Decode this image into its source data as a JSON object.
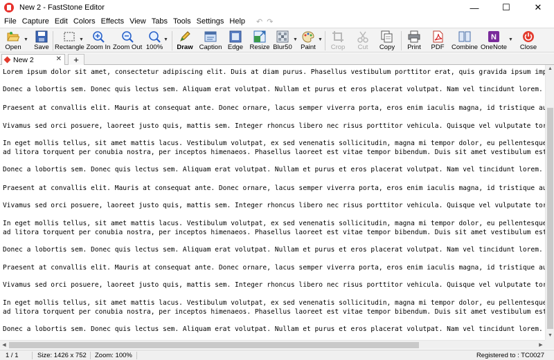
{
  "window": {
    "title": "New 2 - FastStone Editor",
    "minimize_glyph": "—",
    "maximize_glyph": "☐",
    "close_glyph": "✕"
  },
  "menu": [
    "File",
    "Capture",
    "Edit",
    "Colors",
    "Effects",
    "View",
    "Tabs",
    "Tools",
    "Settings",
    "Help"
  ],
  "menu_undo_glyph": "↶",
  "menu_redo_glyph": "↷",
  "toolbar": {
    "open": "Open",
    "save": "Save",
    "rectangle": "Rectangle",
    "zoom_in": "Zoom In",
    "zoom_out": "Zoom Out",
    "zoom_level": "100%",
    "draw": "Draw",
    "caption": "Caption",
    "edge": "Edge",
    "resize": "Resize",
    "blur": "Blur50",
    "paint": "Paint",
    "crop": "Crop",
    "cut": "Cut",
    "copy": "Copy",
    "print": "Print",
    "pdf": "PDF",
    "combine": "Combine",
    "onenote": "OneNote",
    "close": "Close"
  },
  "tabs": {
    "active_label": "New 2",
    "close_glyph": "✕",
    "add_glyph": "+"
  },
  "document": {
    "lines": [
      "Lorem ipsum dolor sit amet, consectetur adipiscing elit. Duis at diam purus. Phasellus vestibulum porttitor erat, quis gravida ipsum imper",
      "Donec a lobortis sem. Donec quis lectus sem. Aliquam erat volutpat. Nullam et purus et eros placerat volutpat. Nam vel tincidunt lorem. Ve",
      "Praesent at convallis elit. Mauris at consequat ante. Donec ornare, lacus semper viverra porta, eros enim iaculis magna, id tristique augu",
      "Vivamus sed orci posuere, laoreet justo quis, mattis sem. Integer rhoncus libero nec risus porttitor vehicula. Quisque vel vulputate torto",
      "In eget mollis tellus, sit amet mattis lacus. Vestibulum volutpat, ex sed venenatis sollicitudin, magna mi tempor dolor, eu pellentesque n",
      "ad litora torquent per conubia nostra, per inceptos himenaeos. Phasellus laoreet est vitae tempor bibendum. Duis sit amet vestibulum est.",
      "Donec a lobortis sem. Donec quis lectus sem. Aliquam erat volutpat. Nullam et purus et eros placerat volutpat. Nam vel tincidunt lorem. Ve",
      "Praesent at convallis elit. Mauris at consequat ante. Donec ornare, lacus semper viverra porta, eros enim iaculis magna, id tristique augu",
      "Vivamus sed orci posuere, laoreet justo quis, mattis sem. Integer rhoncus libero nec risus porttitor vehicula. Quisque vel vulputate torto",
      "In eget mollis tellus, sit amet mattis lacus. Vestibulum volutpat, ex sed venenatis sollicitudin, magna mi tempor dolor, eu pellentesque n",
      "ad litora torquent per conubia nostra, per inceptos himenaeos. Phasellus laoreet est vitae tempor bibendum. Duis sit amet vestibulum est.",
      "Donec a lobortis sem. Donec quis lectus sem. Aliquam erat volutpat. Nullam et purus et eros placerat volutpat. Nam vel tincidunt lorem. Ve",
      "Praesent at convallis elit. Mauris at consequat ante. Donec ornare, lacus semper viverra porta, eros enim iaculis magna, id tristique augu",
      "Vivamus sed orci posuere, laoreet justo quis, mattis sem. Integer rhoncus libero nec risus porttitor vehicula. Quisque vel vulputate torto",
      "In eget mollis tellus, sit amet mattis lacus. Vestibulum volutpat, ex sed venenatis sollicitudin, magna mi tempor dolor, eu pellentesque n",
      "ad litora torquent per conubia nostra, per inceptos himenaeos. Phasellus laoreet est vitae tempor bibendum. Duis sit amet vestibulum est.",
      "Donec a lobortis sem. Donec quis lectus sem. Aliquam erat volutpat. Nullam et purus et eros placerat volutpat. Nam vel tincidunt lorem. Ve"
    ]
  },
  "status": {
    "page": "1 / 1",
    "size": "Size: 1426 x 752",
    "zoom": "Zoom: 100%",
    "registered": "Registered to : TC0027"
  }
}
